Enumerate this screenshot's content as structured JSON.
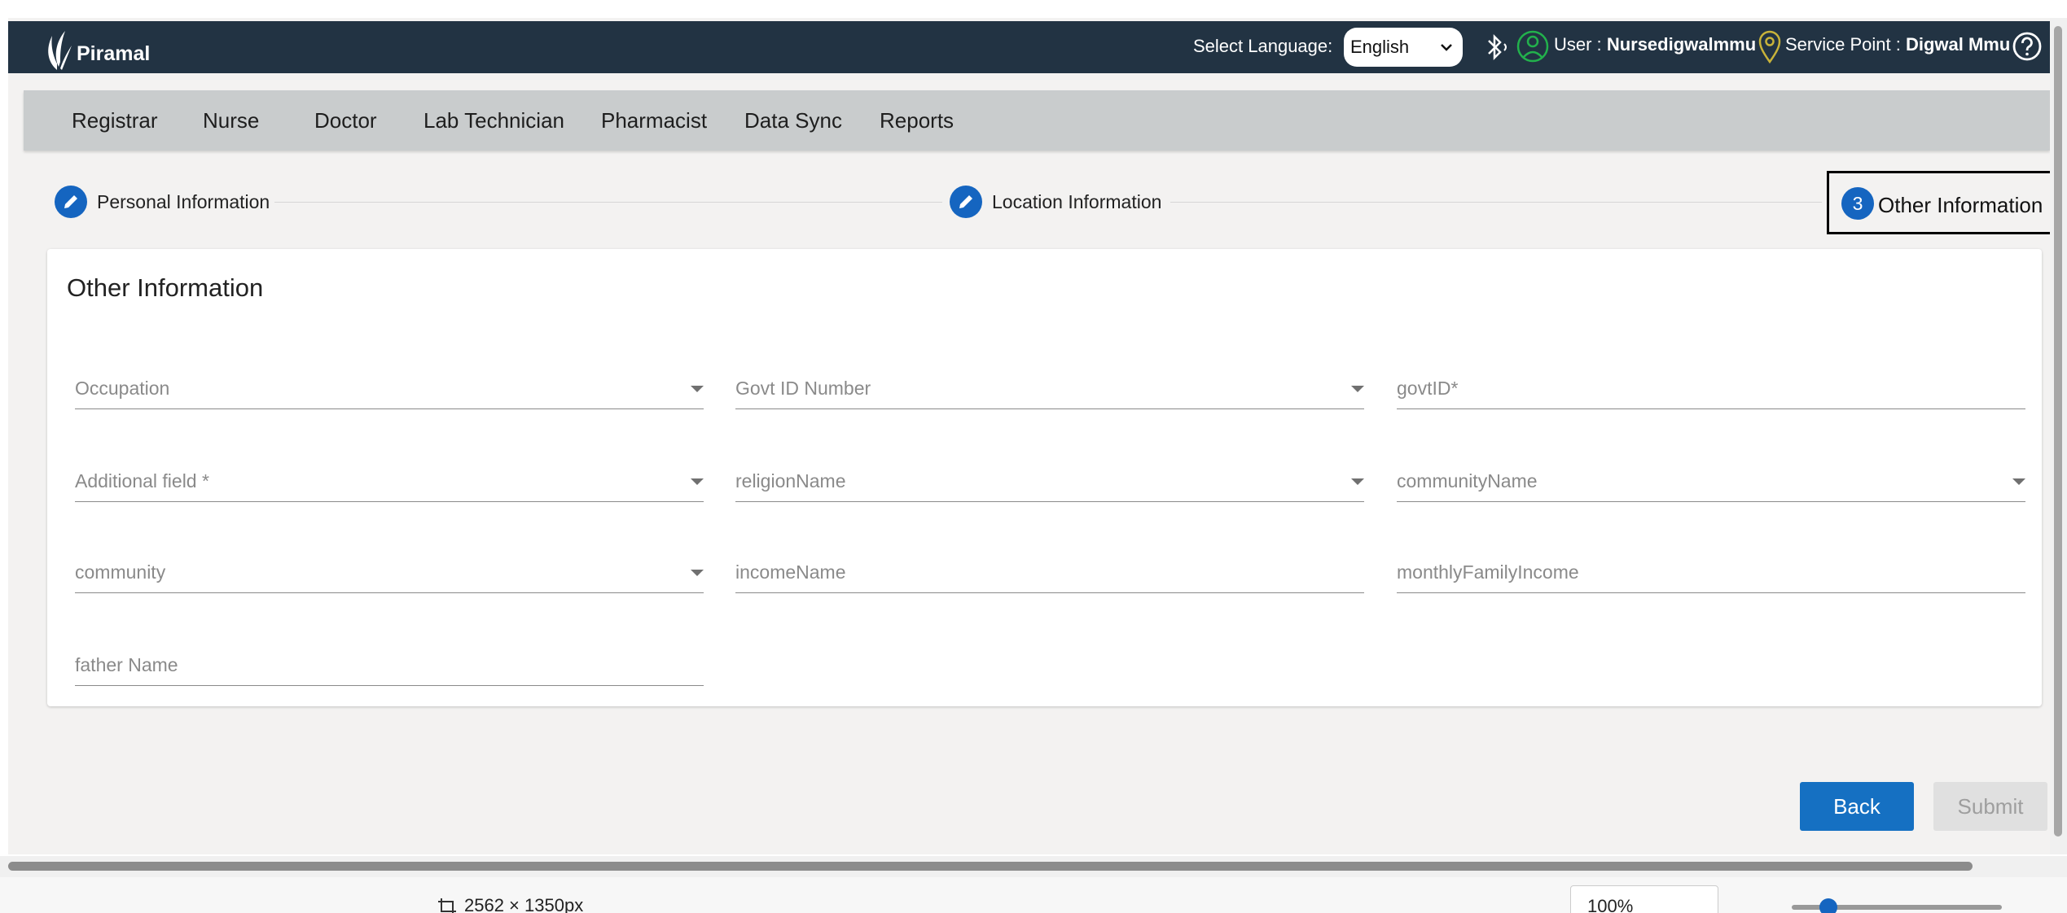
{
  "header": {
    "brand": "Piramal",
    "language_label": "Select Language:",
    "language_value": "English",
    "user_label": "User :",
    "user_name": "Nursedigwalmmu",
    "service_point_label": "Service Point :",
    "service_point_name": "Digwal Mmu"
  },
  "nav": {
    "items": [
      "Registrar",
      "Nurse",
      "Doctor",
      "Lab Technician",
      "Pharmacist",
      "Data Sync",
      "Reports"
    ]
  },
  "stepper": {
    "steps": [
      {
        "label": "Personal Information",
        "state": "edit"
      },
      {
        "label": "Location Information",
        "state": "edit"
      },
      {
        "label": "Other Information",
        "state": "active",
        "number": "3"
      }
    ]
  },
  "form": {
    "title": "Other Information",
    "fields": [
      {
        "placeholder": "Occupation",
        "type": "select"
      },
      {
        "placeholder": "Govt ID Number",
        "type": "select"
      },
      {
        "placeholder": "govtID*",
        "type": "input"
      },
      {
        "placeholder": "Additional field *",
        "type": "select"
      },
      {
        "placeholder": "religionName",
        "type": "select"
      },
      {
        "placeholder": "communityName",
        "type": "select"
      },
      {
        "placeholder": "community",
        "type": "select"
      },
      {
        "placeholder": "incomeName",
        "type": "input"
      },
      {
        "placeholder": "monthlyFamilyIncome",
        "type": "input"
      },
      {
        "placeholder": "father Name",
        "type": "input"
      }
    ]
  },
  "actions": {
    "back_label": "Back",
    "submit_label": "Submit"
  },
  "statusbar": {
    "dimensions": "2562 × 1350px",
    "zoom": "100%"
  },
  "colors": {
    "header_bg": "#223343",
    "nav_bg": "#c9cccd",
    "primary": "#1570c2",
    "disabled_bg": "#e0e0e0"
  }
}
